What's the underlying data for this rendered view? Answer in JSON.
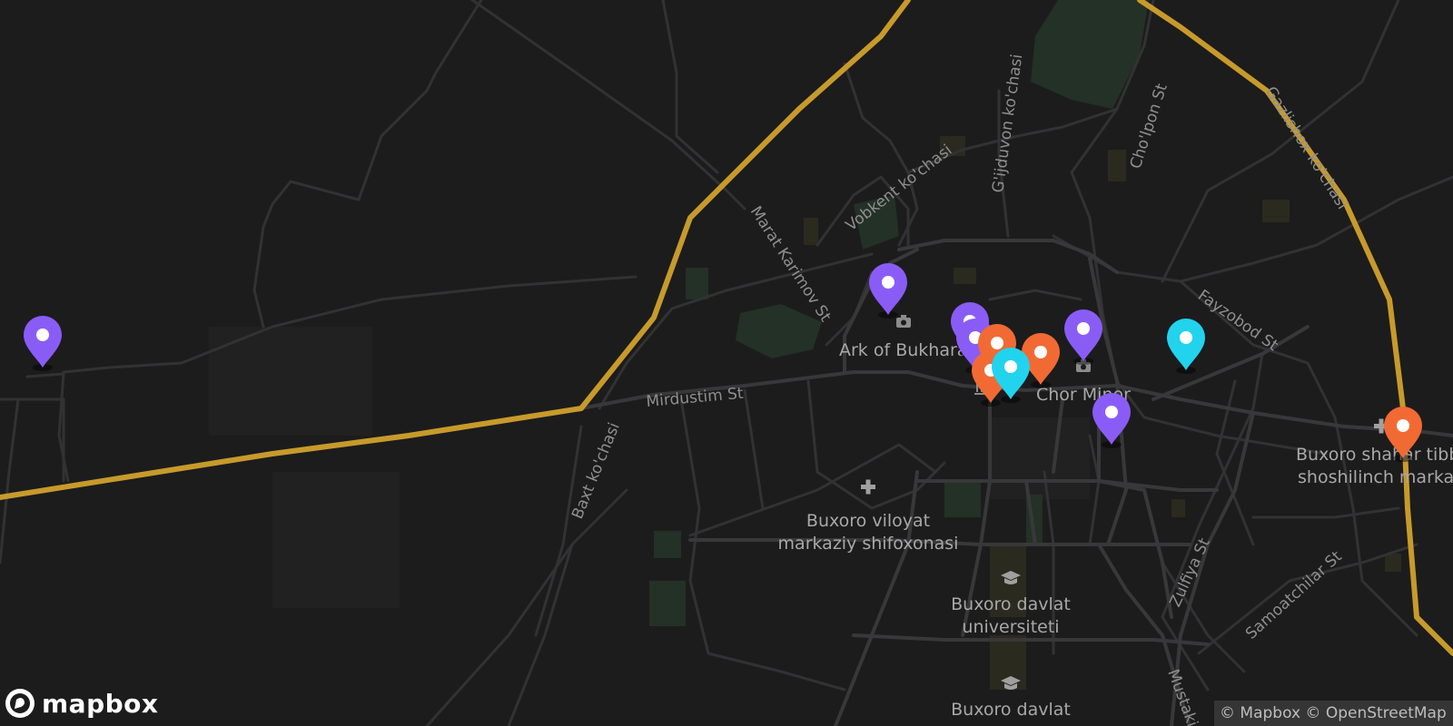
{
  "map": {
    "street_labels": {
      "mirdustim": "Mirdustim St",
      "marat_karimov": "Marat Karimov St",
      "vobkent": "Vobkent ko'chasi",
      "gijduvon": "G'ijduvon ko'chasi",
      "chopon": "Cho'lpon St",
      "gazli": "Gazlishox ko'chasi",
      "fayzobod": "Fayzobod St",
      "baxt": "Baxt ko'chasi",
      "zulfiya": "Zulfiya St",
      "samoatchilar": "Samoatchilar St",
      "mustaqillik": "Mustaki"
    },
    "poi_labels": {
      "ark": "Ark of Bukhara",
      "chor_minor": "Chor Minor",
      "hospital_line1": "Buxoro viloyat",
      "hospital_line2": "markaziy shifoxonasi",
      "university_line1": "Buxoro davlat",
      "university_line2": "universiteti",
      "university2_line1": "Buxoro davlat",
      "emergency_line1": "Buxoro shahar tibb",
      "emergency_line2": "shoshilinch marka"
    },
    "icons": [
      "camera-icon",
      "hospital-cross-icon",
      "graduation-cap-icon",
      "museum-icon"
    ],
    "colors": {
      "background": "#1c1c1d",
      "road": "#38383a",
      "highway": "#c79a2b",
      "marker_purple": "#8a5cf6",
      "marker_orange": "#f26a33",
      "marker_cyan": "#22d3ee"
    },
    "markers": [
      {
        "color": "purple"
      },
      {
        "color": "purple"
      },
      {
        "color": "purple"
      },
      {
        "color": "purple"
      },
      {
        "color": "purple"
      },
      {
        "color": "purple"
      },
      {
        "color": "orange"
      },
      {
        "color": "orange"
      },
      {
        "color": "orange"
      },
      {
        "color": "orange"
      },
      {
        "color": "cyan"
      },
      {
        "color": "cyan"
      }
    ]
  },
  "branding": {
    "logo_text": "mapbox",
    "attribution": "© Mapbox © OpenStreetMap"
  }
}
